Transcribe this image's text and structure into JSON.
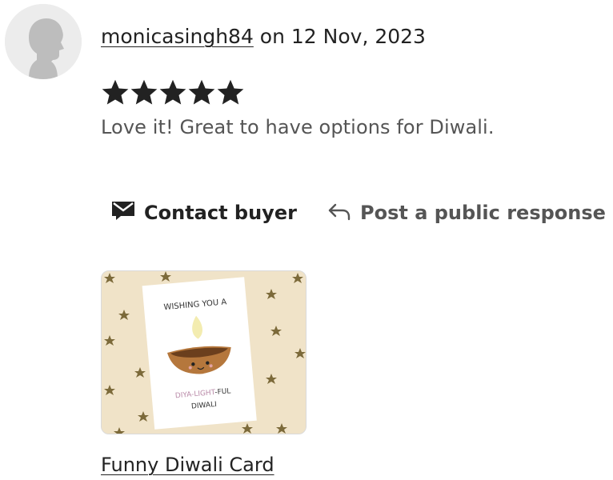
{
  "review": {
    "username": "monicasingh84",
    "date_text": " on 12 Nov, 2023",
    "rating": 5,
    "text": "Love it! Great to have options for Diwali."
  },
  "actions": {
    "contact_label": "Contact buyer",
    "public_response_label": "Post a public response"
  },
  "listing": {
    "title": "Funny Diwali Card",
    "card_text_line1": "WISHING YOU A",
    "card_text_line2a": "DIYA-",
    "card_text_line2b": "LIGHT",
    "card_text_line2c": "-FUL",
    "card_text_line3": "DIWALI"
  },
  "colors": {
    "text": "#222222",
    "muted": "#555555",
    "avatar_bg": "#ececec",
    "card_bg": "#f0e3c8"
  },
  "icons": {
    "avatar": "user-silhouette-icon",
    "star": "star-icon",
    "contact": "envelope-icon",
    "public": "reply-arrow-icon"
  }
}
